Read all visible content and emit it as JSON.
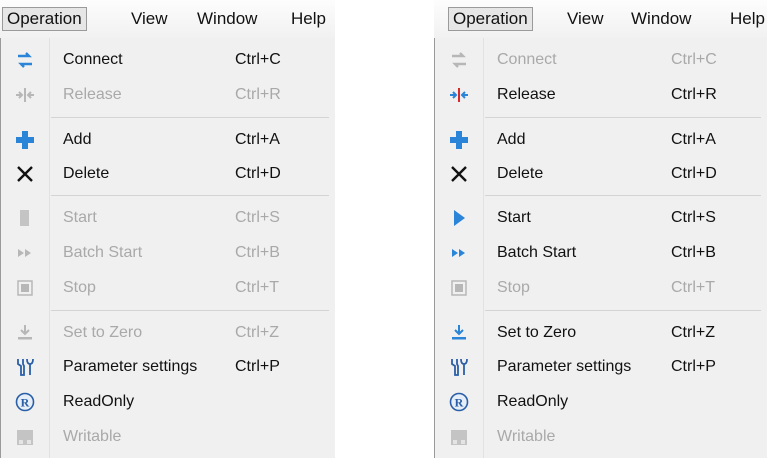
{
  "colors": {
    "blue_accent": "#2a84d8",
    "red_accent": "#d8282a",
    "disabled_text": "#a9a9a9",
    "menu_bg": "#f0f0f0"
  },
  "panels": [
    {
      "menubar": [
        "Operation",
        "View",
        "Window",
        "Help"
      ],
      "items": [
        {
          "label": "Connect",
          "shortcut": "Ctrl+C",
          "icon": "connect-icon",
          "enabled": true
        },
        {
          "label": "Release",
          "shortcut": "Ctrl+R",
          "icon": "release-icon",
          "enabled": false
        },
        {
          "label": "Add",
          "shortcut": "Ctrl+A",
          "icon": "add-icon",
          "enabled": true
        },
        {
          "label": "Delete",
          "shortcut": "Ctrl+D",
          "icon": "delete-icon",
          "enabled": true
        },
        {
          "label": "Start",
          "shortcut": "Ctrl+S",
          "icon": "start-icon",
          "enabled": false
        },
        {
          "label": "Batch Start",
          "shortcut": "Ctrl+B",
          "icon": "batch-start-icon",
          "enabled": false
        },
        {
          "label": "Stop",
          "shortcut": "Ctrl+T",
          "icon": "stop-icon",
          "enabled": false
        },
        {
          "label": "Set to Zero",
          "shortcut": "Ctrl+Z",
          "icon": "set-to-zero-icon",
          "enabled": false
        },
        {
          "label": "Parameter settings",
          "shortcut": "Ctrl+P",
          "icon": "wrench-icon",
          "enabled": true
        },
        {
          "label": "ReadOnly",
          "shortcut": "",
          "icon": "readonly-icon",
          "enabled": true
        },
        {
          "label": "Writable",
          "shortcut": "",
          "icon": "writable-icon",
          "enabled": false
        }
      ]
    },
    {
      "menubar": [
        "Operation",
        "View",
        "Window",
        "Help"
      ],
      "items": [
        {
          "label": "Connect",
          "shortcut": "Ctrl+C",
          "icon": "connect-icon",
          "enabled": false
        },
        {
          "label": "Release",
          "shortcut": "Ctrl+R",
          "icon": "release-icon",
          "enabled": true
        },
        {
          "label": "Add",
          "shortcut": "Ctrl+A",
          "icon": "add-icon",
          "enabled": true
        },
        {
          "label": "Delete",
          "shortcut": "Ctrl+D",
          "icon": "delete-icon",
          "enabled": true
        },
        {
          "label": "Start",
          "shortcut": "Ctrl+S",
          "icon": "start-icon",
          "enabled": true
        },
        {
          "label": "Batch Start",
          "shortcut": "Ctrl+B",
          "icon": "batch-start-icon",
          "enabled": true
        },
        {
          "label": "Stop",
          "shortcut": "Ctrl+T",
          "icon": "stop-icon",
          "enabled": false
        },
        {
          "label": "Set to Zero",
          "shortcut": "Ctrl+Z",
          "icon": "set-to-zero-icon",
          "enabled": true
        },
        {
          "label": "Parameter settings",
          "shortcut": "Ctrl+P",
          "icon": "wrench-icon",
          "enabled": true
        },
        {
          "label": "ReadOnly",
          "shortcut": "",
          "icon": "readonly-icon",
          "enabled": true
        },
        {
          "label": "Writable",
          "shortcut": "",
          "icon": "writable-icon",
          "enabled": false
        }
      ]
    }
  ]
}
